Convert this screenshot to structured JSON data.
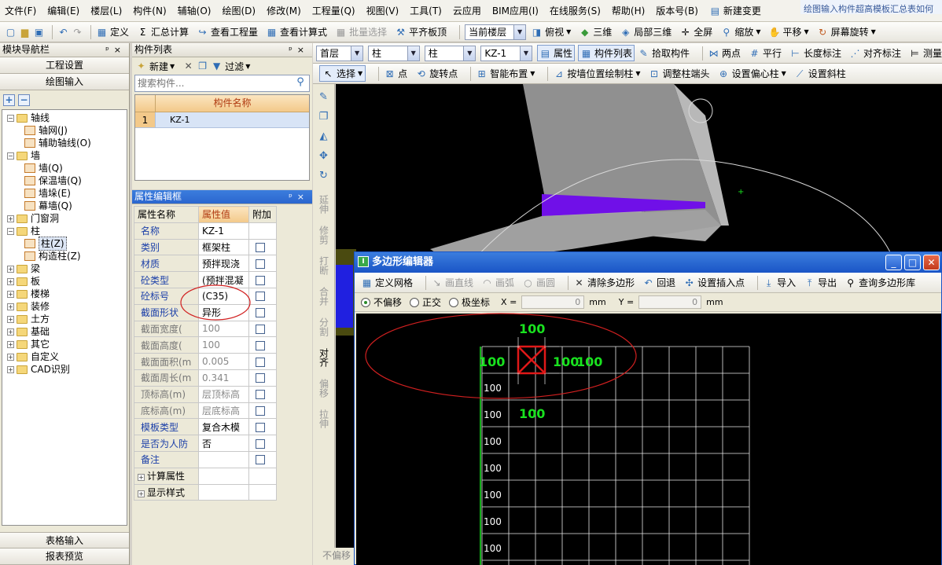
{
  "menu": {
    "items": [
      "文件(F)",
      "编辑(E)",
      "楼层(L)",
      "构件(N)",
      "辅轴(O)",
      "绘图(D)",
      "修改(M)",
      "工程量(Q)",
      "视图(V)",
      "工具(T)",
      "云应用",
      "BIM应用(I)",
      "在线服务(S)",
      "帮助(H)",
      "版本号(B)"
    ],
    "new_change": "新建变更",
    "notice": "绘图输入构件超高模板汇总表如何"
  },
  "toolbar1": {
    "define": "定义",
    "sum_calc": "汇总计算",
    "view_qty": "查看工程量",
    "view_formula": "查看计算式",
    "batch_select": "批量选择",
    "flat_slab_top": "平齐板顶",
    "floor_combo": "当前楼层",
    "top_view": "俯视",
    "three_d": "三维",
    "local_3d": "局部三维",
    "fullscreen": "全屏",
    "zoom": "缩放",
    "pan": "平移",
    "screen_rotate": "屏幕旋转"
  },
  "nav": {
    "title": "模块导航栏",
    "project_settings": "工程设置",
    "drawing_input": "绘图输入",
    "table_input": "表格输入",
    "report_preview": "报表预览",
    "tree": [
      {
        "label": "轴线",
        "level": 0,
        "expanded": true
      },
      {
        "label": "轴网(J)",
        "level": 1
      },
      {
        "label": "辅助轴线(O)",
        "level": 1
      },
      {
        "label": "墙",
        "level": 0,
        "expanded": true
      },
      {
        "label": "墙(Q)",
        "level": 1
      },
      {
        "label": "保温墙(Q)",
        "level": 1
      },
      {
        "label": "墙垛(E)",
        "level": 1
      },
      {
        "label": "幕墙(Q)",
        "level": 1
      },
      {
        "label": "门窗洞",
        "level": 0,
        "expanded": false
      },
      {
        "label": "柱",
        "level": 0,
        "expanded": true
      },
      {
        "label": "柱(Z)",
        "level": 1,
        "selected": true
      },
      {
        "label": "构造柱(Z)",
        "level": 1
      },
      {
        "label": "梁",
        "level": 0,
        "expanded": false
      },
      {
        "label": "板",
        "level": 0,
        "expanded": false
      },
      {
        "label": "楼梯",
        "level": 0,
        "expanded": false
      },
      {
        "label": "装修",
        "level": 0,
        "expanded": false
      },
      {
        "label": "土方",
        "level": 0,
        "expanded": false
      },
      {
        "label": "基础",
        "level": 0,
        "expanded": false
      },
      {
        "label": "其它",
        "level": 0,
        "expanded": false
      },
      {
        "label": "自定义",
        "level": 0,
        "expanded": false
      },
      {
        "label": "CAD识别",
        "level": 0,
        "expanded": false
      }
    ]
  },
  "component_list": {
    "title": "构件列表",
    "new_label": "新建",
    "filter_label": "过滤",
    "search_placeholder": "搜索构件...",
    "column_header": "构件名称",
    "rows": [
      {
        "index": "1",
        "name": "KZ-1"
      }
    ]
  },
  "properties": {
    "title": "属性编辑框",
    "headers": [
      "属性名称",
      "属性值",
      "附加"
    ],
    "rows": [
      {
        "name": "名称",
        "value": "KZ-1",
        "blue": true,
        "chk": false
      },
      {
        "name": "类别",
        "value": "框架柱",
        "blue": true,
        "chk": true
      },
      {
        "name": "材质",
        "value": "预拌现浇",
        "blue": true,
        "chk": true
      },
      {
        "name": "砼类型",
        "value": "(预拌混凝",
        "blue": true,
        "chk": true
      },
      {
        "name": "砼标号",
        "value": "(C35)",
        "blue": true,
        "chk": true
      },
      {
        "name": "截面形状",
        "value": "异形",
        "blue": true,
        "chk": true
      },
      {
        "name": "截面宽度(",
        "value": "100",
        "blue": false,
        "chk": true
      },
      {
        "name": "截面高度(",
        "value": "100",
        "blue": false,
        "chk": true
      },
      {
        "name": "截面面积(m",
        "value": "0.005",
        "blue": false,
        "chk": true
      },
      {
        "name": "截面周长(m",
        "value": "0.341",
        "blue": false,
        "chk": true
      },
      {
        "name": "顶标高(m)",
        "value": "层顶标高",
        "blue": false,
        "chk": true
      },
      {
        "name": "底标高(m)",
        "value": "层底标高",
        "blue": false,
        "chk": true
      },
      {
        "name": "模板类型",
        "value": "复合木模",
        "blue": true,
        "chk": true
      },
      {
        "name": "是否为人防",
        "value": "否",
        "blue": true,
        "chk": true
      },
      {
        "name": "备注",
        "value": "",
        "blue": true,
        "chk": true
      }
    ],
    "groups": [
      "计算属性",
      "显示样式"
    ]
  },
  "toolbar2": {
    "floor": "首层",
    "type1": "柱",
    "type2": "柱",
    "component": "KZ-1",
    "attributes": "属性",
    "component_list": "构件列表",
    "pick": "拾取构件",
    "two_points": "两点",
    "parallel": "平行",
    "length_dim": "长度标注",
    "align_dim": "对齐标注",
    "measure": "测量"
  },
  "toolbar3": {
    "select": "选择",
    "point": "点",
    "rotate_point": "旋转点",
    "smart_layout": "智能布置",
    "draw_by_wall": "按墙位置绘制柱",
    "adjust_end": "调整柱端头",
    "set_eccentric": "设置偏心柱",
    "set_slope": "设置斜柱"
  },
  "side_tools": [
    "延伸",
    "修剪",
    "打断",
    "合并",
    "分割",
    "对齐",
    "偏移",
    "拉伸"
  ],
  "status": {
    "no_offset": "不偏移"
  },
  "polygon_editor": {
    "title": "多边形编辑器",
    "toolbar": {
      "define_grid": "定义网格",
      "draw_line": "画直线",
      "draw_arc": "画弧",
      "draw_circle": "画圆",
      "clear": "清除多边形",
      "undo": "回退",
      "set_insert": "设置插入点",
      "import": "导入",
      "export": "导出",
      "query_lib": "查询多边形库"
    },
    "mode": {
      "no_offset": "不偏移",
      "orthogonal": "正交",
      "polar": "极坐标",
      "x_label": "X =",
      "x_value": "0",
      "y_label": "Y =",
      "y_value": "0",
      "unit": "mm"
    },
    "dims": {
      "top": "100",
      "left": "100",
      "right1": "100",
      "right2": "100",
      "bottom": "100"
    },
    "row_labels": [
      "100",
      "100",
      "100",
      "100",
      "100",
      "100",
      "100",
      "100"
    ]
  },
  "colors": {
    "accent_blue": "#1a55c6",
    "dim_green": "#19e21f",
    "annotation_red": "#d12020",
    "purple_face": "#7010e8"
  }
}
